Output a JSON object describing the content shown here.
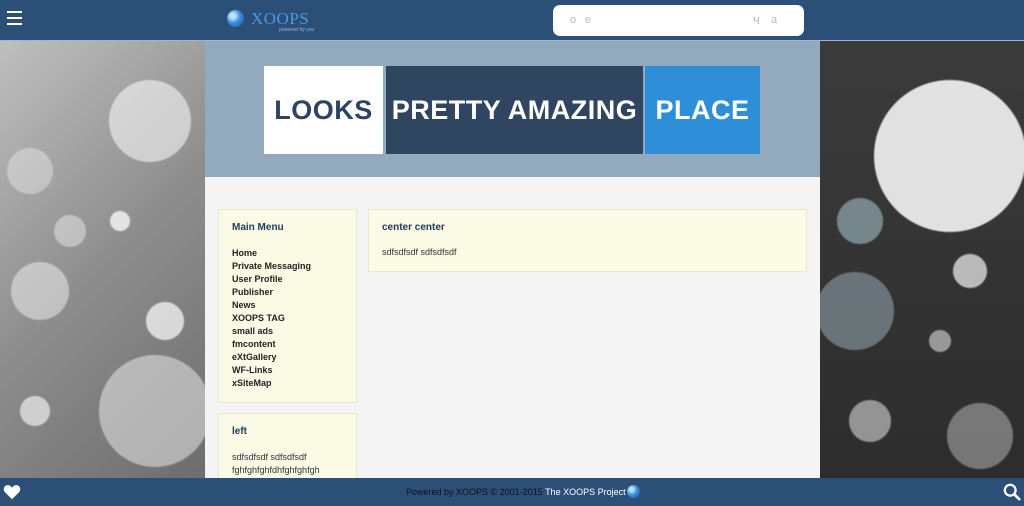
{
  "header": {
    "logo_text": "XOOPS",
    "logo_tagline": "powered by you",
    "search": {
      "glyphs": [
        "o",
        "e",
        "ч",
        "a"
      ]
    }
  },
  "banner": {
    "words": [
      "LOOKS",
      "PRETTY AMAZING",
      "PLACE"
    ]
  },
  "main_menu": {
    "title": "Main Menu",
    "items": [
      "Home",
      "Private Messaging",
      "User Profile",
      "Publisher",
      "News",
      "XOOPS TAG",
      "small ads",
      "fmcontent",
      "eXtGallery",
      "WF-Links",
      "xSiteMap"
    ]
  },
  "left_block": {
    "title": "left",
    "lines": [
      "sdfsdfsdf sdfsdfsdf",
      "fghfghfghfdhfghfghfgh"
    ]
  },
  "center_block": {
    "title": "center center",
    "text": "sdfsdfsdf sdfsdfsdf"
  },
  "footer": {
    "text": "Powered by XOOPS © 2001-2015 ",
    "link": "The XOOPS Project"
  },
  "colors": {
    "bar": "#2c4f78",
    "box_white": "#ffffff",
    "box_dark": "#2f4560",
    "box_blue": "#2f8ed8",
    "block_bg": "#fafae5"
  }
}
